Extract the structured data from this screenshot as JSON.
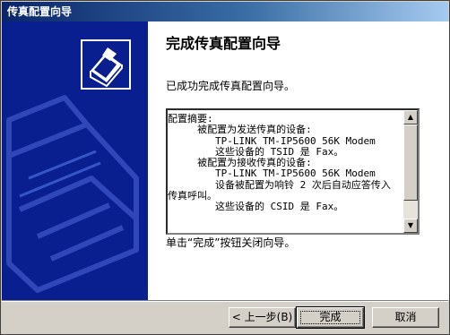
{
  "window": {
    "title": "传真配置向导"
  },
  "main": {
    "heading": "完成传真配置向导",
    "success_text": "已成功完成传真配置向导。",
    "summary_lines": [
      "配置摘要:",
      "",
      "     被配置为发送传真的设备:",
      "        TP-LINK TM-IP5600 56K Modem",
      "        这些设备的 TSID 是 Fax。",
      "",
      "     被配置为接收传真的设备:",
      "        TP-LINK TM-IP5600 56K Modem",
      "        设备被配置为响铃 2 次后自动应答传入",
      "传真呼叫。",
      "        这些设备的 CSID 是 Fax。"
    ],
    "finish_hint": "单击“完成”按钮关闭向导。"
  },
  "scrollbar": {
    "up_icon": "scroll-up-arrow",
    "down_icon": "scroll-down-arrow"
  },
  "buttons": {
    "back": "< 上一步(B)",
    "finish": "完成",
    "cancel": "取消"
  }
}
